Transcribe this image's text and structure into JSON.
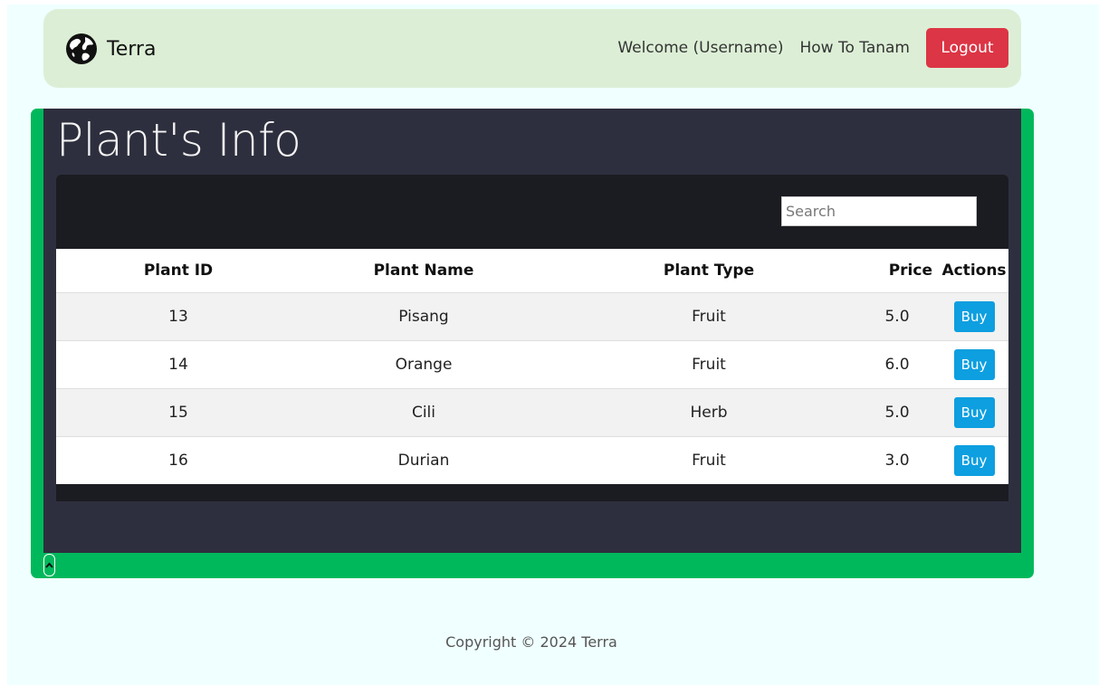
{
  "navbar": {
    "brand_icon": "globe-icon",
    "brand": "Terra",
    "welcome": "Welcome (Username)",
    "how_to": "How To Tanam",
    "logout": "Logout",
    "logout_color": "#dc3545"
  },
  "main": {
    "title": "Plant's Info",
    "search_placeholder": "Search",
    "accent_color": "#00b85c",
    "table": {
      "headers": [
        "Plant ID",
        "Plant Name",
        "Plant Type",
        "Price",
        "Actions"
      ],
      "rows": [
        {
          "id": "13",
          "name": "Pisang",
          "type": "Fruit",
          "price": "5.0",
          "action": "Buy"
        },
        {
          "id": "14",
          "name": "Orange",
          "type": "Fruit",
          "price": "6.0",
          "action": "Buy"
        },
        {
          "id": "15",
          "name": "Cili",
          "type": "Herb",
          "price": "5.0",
          "action": "Buy"
        },
        {
          "id": "16",
          "name": "Durian",
          "type": "Fruit",
          "price": "3.0",
          "action": "Buy"
        }
      ]
    },
    "scroll_toggle_icon": "chevron-up-icon"
  },
  "footer": {
    "copyright": "Copyright © 2024 Terra"
  }
}
